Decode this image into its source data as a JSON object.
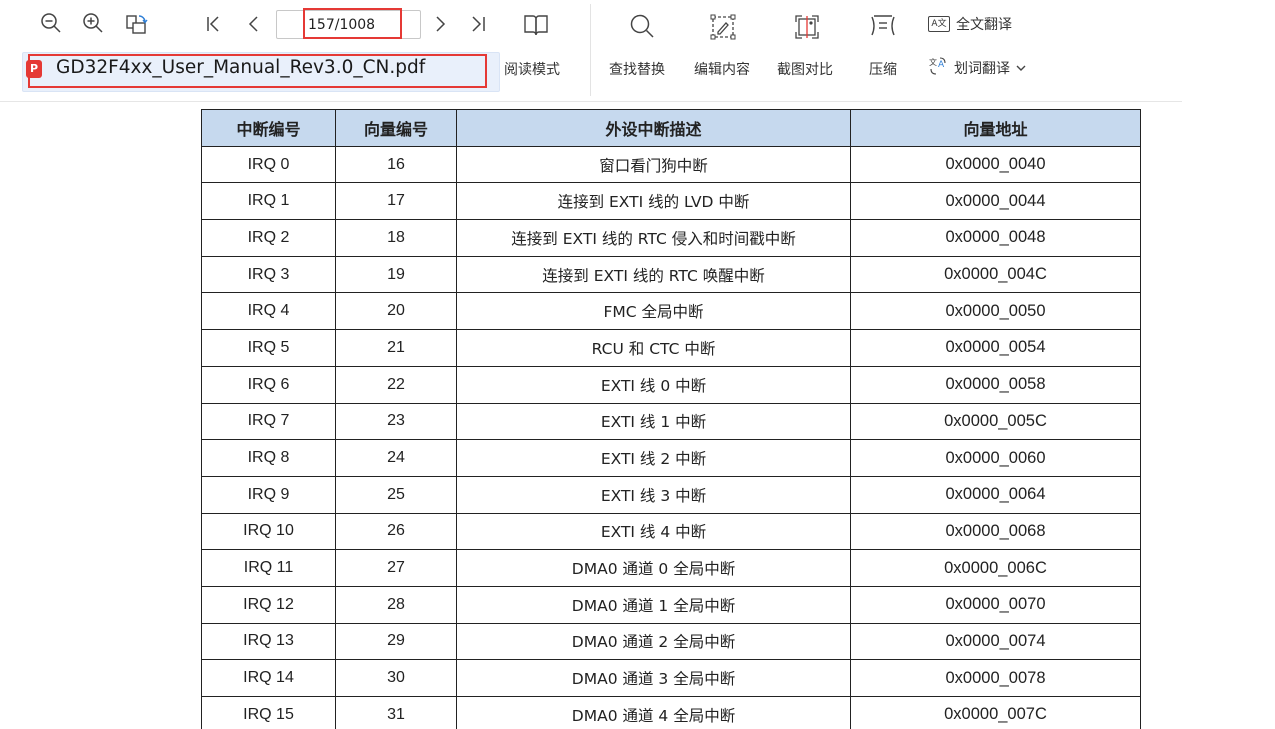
{
  "toolbar": {
    "page_value": "157/1008",
    "file_name": "GD32F4xx_User_Manual_Rev3.0_CN.pdf",
    "file_badge": "P",
    "read_mode_label": "阅读模式",
    "tools": [
      {
        "label": "查找替换",
        "icon": "search-icon"
      },
      {
        "label": "编辑内容",
        "icon": "edit-content-icon"
      },
      {
        "label": "截图对比",
        "icon": "screenshot-compare-icon"
      },
      {
        "label": "压缩",
        "icon": "compress-icon"
      }
    ],
    "full_translate_label": "全文翻译",
    "full_translate_icon_text": "A文",
    "word_translate_label": "划词翻译",
    "accent_highlight": "#e53935"
  },
  "table": {
    "headers": [
      "中断编号",
      "向量编号",
      "外设中断描述",
      "向量地址"
    ],
    "header_bg": "#c6d9ee",
    "rows": [
      {
        "irq": "IRQ 0",
        "vec": "16",
        "desc": "窗口看门狗中断",
        "addr": "0x0000_0040"
      },
      {
        "irq": "IRQ 1",
        "vec": "17",
        "desc": "连接到 EXTI 线的 LVD 中断",
        "addr": "0x0000_0044"
      },
      {
        "irq": "IRQ 2",
        "vec": "18",
        "desc": "连接到 EXTI 线的 RTC 侵入和时间戳中断",
        "addr": "0x0000_0048"
      },
      {
        "irq": "IRQ 3",
        "vec": "19",
        "desc": "连接到 EXTI 线的 RTC 唤醒中断",
        "addr": "0x0000_004C"
      },
      {
        "irq": "IRQ 4",
        "vec": "20",
        "desc": "FMC 全局中断",
        "addr": "0x0000_0050"
      },
      {
        "irq": "IRQ 5",
        "vec": "21",
        "desc": "RCU 和 CTC 中断",
        "addr": "0x0000_0054"
      },
      {
        "irq": "IRQ 6",
        "vec": "22",
        "desc": "EXTI 线 0 中断",
        "addr": "0x0000_0058"
      },
      {
        "irq": "IRQ 7",
        "vec": "23",
        "desc": "EXTI 线 1 中断",
        "addr": "0x0000_005C"
      },
      {
        "irq": "IRQ 8",
        "vec": "24",
        "desc": "EXTI 线 2 中断",
        "addr": "0x0000_0060"
      },
      {
        "irq": "IRQ 9",
        "vec": "25",
        "desc": "EXTI 线 3 中断",
        "addr": "0x0000_0064"
      },
      {
        "irq": "IRQ 10",
        "vec": "26",
        "desc": "EXTI 线 4 中断",
        "addr": "0x0000_0068"
      },
      {
        "irq": "IRQ 11",
        "vec": "27",
        "desc": "DMA0 通道 0 全局中断",
        "addr": "0x0000_006C"
      },
      {
        "irq": "IRQ 12",
        "vec": "28",
        "desc": "DMA0 通道 1 全局中断",
        "addr": "0x0000_0070"
      },
      {
        "irq": "IRQ 13",
        "vec": "29",
        "desc": "DMA0 通道 2 全局中断",
        "addr": "0x0000_0074"
      },
      {
        "irq": "IRQ 14",
        "vec": "30",
        "desc": "DMA0 通道 3 全局中断",
        "addr": "0x0000_0078"
      },
      {
        "irq": "IRQ 15",
        "vec": "31",
        "desc": "DMA0 通道 4 全局中断",
        "addr": "0x0000_007C"
      }
    ]
  }
}
